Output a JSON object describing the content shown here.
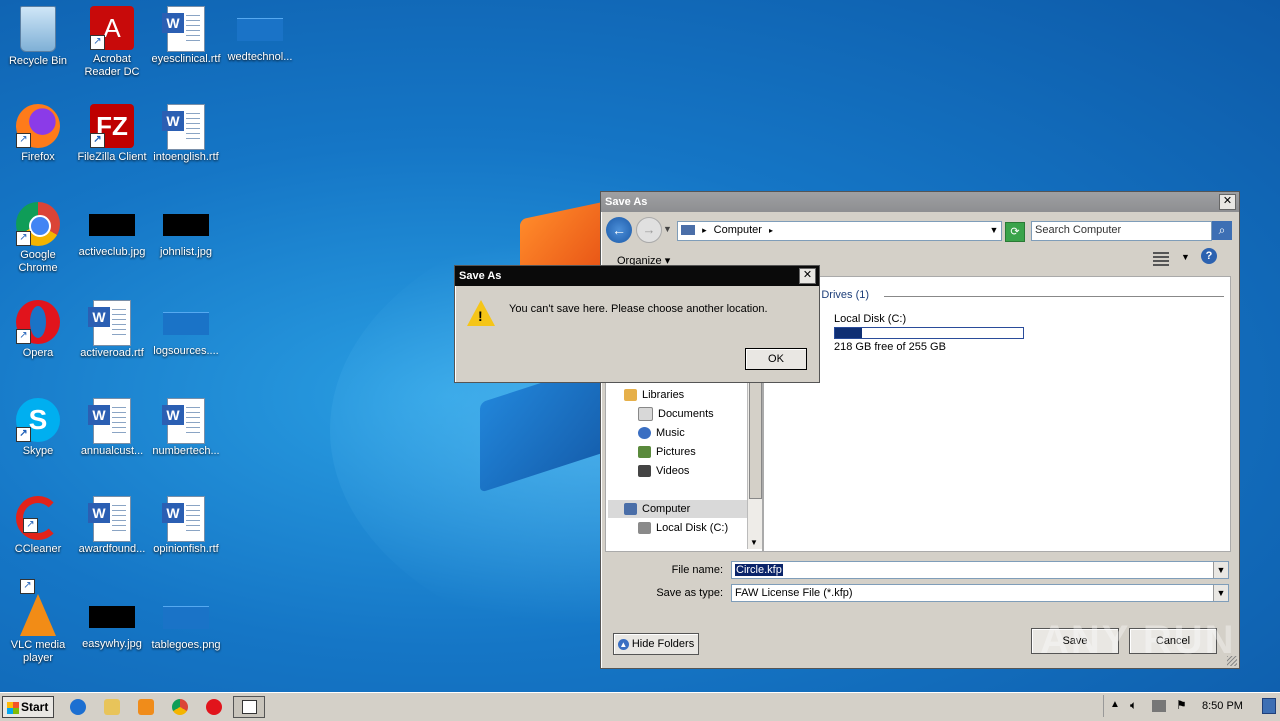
{
  "desktop": {
    "icons": [
      {
        "label": "Recycle Bin"
      },
      {
        "label": "Acrobat Reader DC"
      },
      {
        "label": "eyesclinical.rtf"
      },
      {
        "label": "wedtechnol..."
      },
      {
        "label": "Firefox"
      },
      {
        "label": "FileZilla Client"
      },
      {
        "label": "intoenglish.rtf"
      },
      {
        "label": "Google Chrome"
      },
      {
        "label": "activeclub.jpg"
      },
      {
        "label": "johnlist.jpg"
      },
      {
        "label": "Opera"
      },
      {
        "label": "activeroad.rtf"
      },
      {
        "label": "logsources...."
      },
      {
        "label": "Skype"
      },
      {
        "label": "annualcust..."
      },
      {
        "label": "numbertech..."
      },
      {
        "label": "CCleaner"
      },
      {
        "label": "awardfound..."
      },
      {
        "label": "opinionfish.rtf"
      },
      {
        "label": "VLC media player"
      },
      {
        "label": "easywhy.jpg"
      },
      {
        "label": "tablegoes.png"
      }
    ]
  },
  "save_as": {
    "title": "Save As",
    "address": "Computer",
    "search_placeholder": "Search Computer",
    "organize": "Organize",
    "section_header": "Hard Disk Drives (1)",
    "disk_name": "Local Disk (C:)",
    "disk_free": "218 GB free of 255 GB",
    "disk_used_fraction": 0.145,
    "tree": [
      "Libraries",
      "Documents",
      "Music",
      "Pictures",
      "Videos",
      "Computer",
      "Local Disk (C:)"
    ],
    "file_name_label": "File name:",
    "file_name_value": "Circle.kfp",
    "save_type_label": "Save as type:",
    "save_type_value": "FAW License File (*.kfp)",
    "hide_folders": "Hide Folders",
    "save": "Save",
    "cancel": "Cancel"
  },
  "alert": {
    "title": "Save As",
    "message": "You can't save here. Please choose another location.",
    "ok": "OK"
  },
  "taskbar": {
    "start": "Start",
    "clock": "8:50 PM"
  },
  "watermark": "ANY RUN"
}
